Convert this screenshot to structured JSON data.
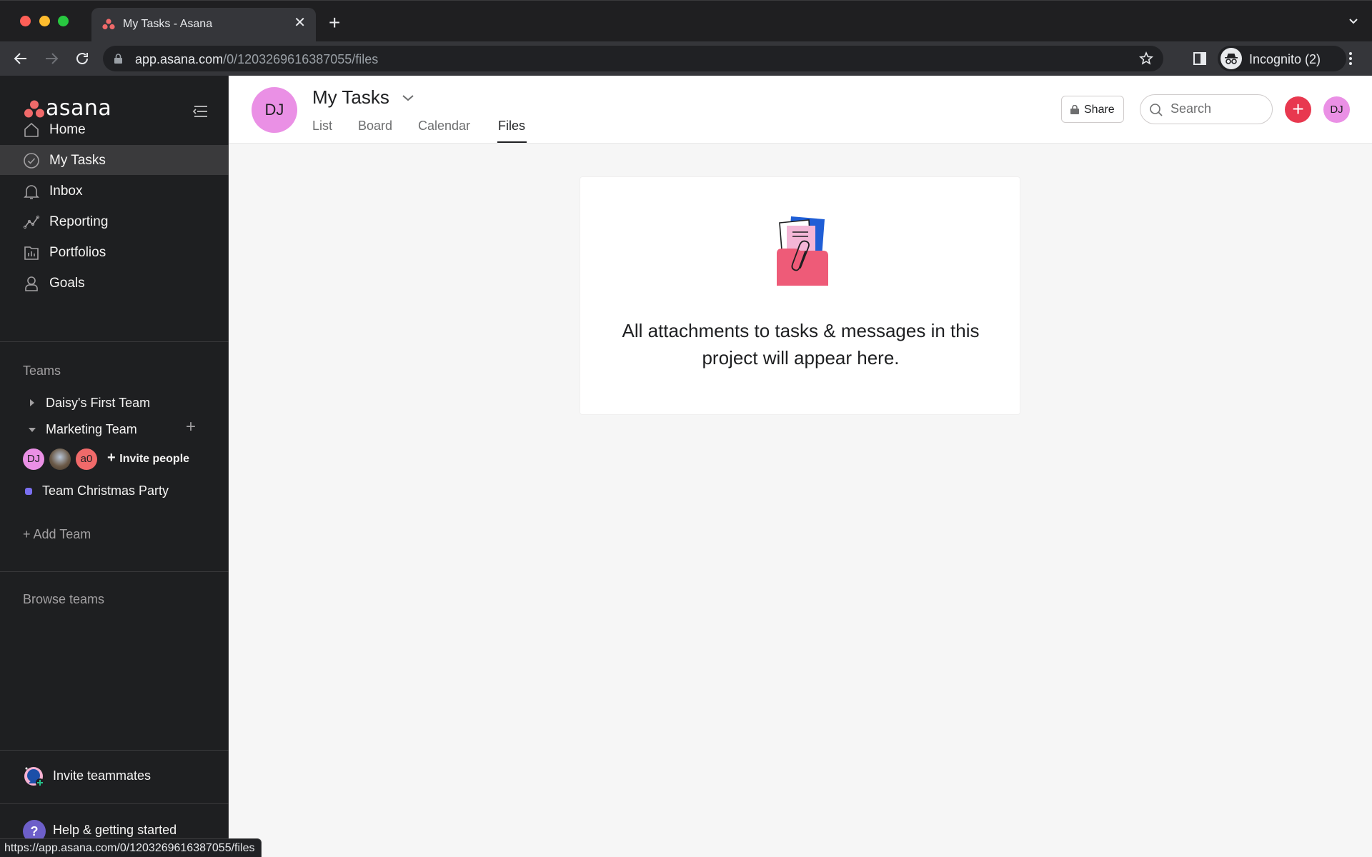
{
  "browser": {
    "tab_title": "My Tasks - Asana",
    "url_domain": "app.asana.com",
    "url_path": "/0/1203269616387055/files",
    "incognito_label": "Incognito (2)",
    "status_url": "https://app.asana.com/0/1203269616387055/files"
  },
  "sidebar": {
    "logo_text": "asana",
    "nav": [
      {
        "label": "Home",
        "icon": "home-icon"
      },
      {
        "label": "My Tasks",
        "icon": "check-circle-icon",
        "active": true
      },
      {
        "label": "Inbox",
        "icon": "bell-icon"
      },
      {
        "label": "Reporting",
        "icon": "line-chart-icon"
      },
      {
        "label": "Portfolios",
        "icon": "portfolio-icon"
      },
      {
        "label": "Goals",
        "icon": "goal-person-icon"
      }
    ],
    "teams_title": "Teams",
    "teams": [
      {
        "label": "Daisy's First Team",
        "expanded": false
      },
      {
        "label": "Marketing Team",
        "expanded": true
      }
    ],
    "team_members": [
      {
        "initials": "DJ",
        "color": "#ea90e5"
      },
      {
        "initials": "",
        "color": "#8a7a6a",
        "photo": true
      },
      {
        "initials": "a0",
        "color": "#f06a6a"
      }
    ],
    "invite_people_label": "Invite people",
    "project": {
      "label": "Team Christmas Party",
      "color": "#7a6ff0"
    },
    "add_team_label": "Add Team",
    "browse_teams_label": "Browse teams",
    "invite_teammates_label": "Invite teammates",
    "help_label": "Help & getting started"
  },
  "header": {
    "avatar_initials": "DJ",
    "title": "My Tasks",
    "tabs": [
      {
        "label": "List"
      },
      {
        "label": "Board"
      },
      {
        "label": "Calendar"
      },
      {
        "label": "Files",
        "active": true
      }
    ],
    "share_label": "Share",
    "search_placeholder": "Search",
    "user_initials": "DJ"
  },
  "empty_state": {
    "message": "All attachments to tasks & messages in this project will appear here."
  },
  "colors": {
    "brand_red": "#e8384f",
    "avatar_pink": "#ea90e5",
    "sidebar_bg": "#1e1f21",
    "active_nav_bg": "#3a3a3c"
  }
}
